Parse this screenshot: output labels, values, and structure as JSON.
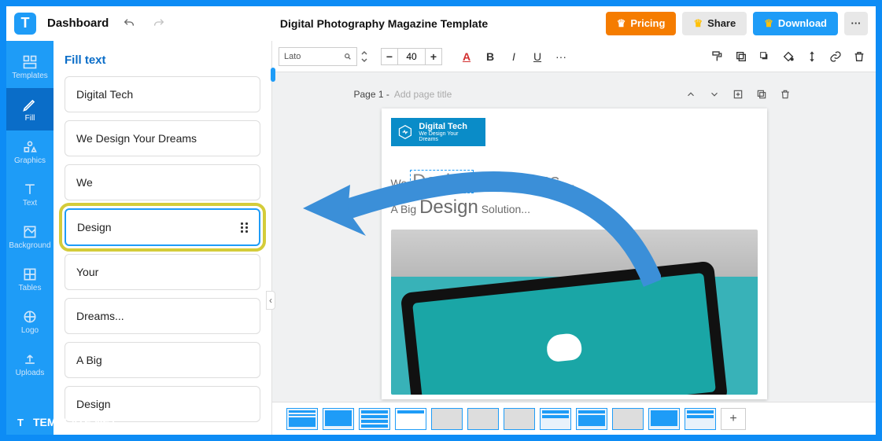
{
  "header": {
    "dashboard": "Dashboard",
    "title": "Digital Photography Magazine Template",
    "pricing": "Pricing",
    "share": "Share",
    "download": "Download"
  },
  "sidenav": [
    {
      "label": "Templates"
    },
    {
      "label": "Fill"
    },
    {
      "label": "Graphics"
    },
    {
      "label": "Text"
    },
    {
      "label": "Background"
    },
    {
      "label": "Tables"
    },
    {
      "label": "Logo"
    },
    {
      "label": "Uploads"
    }
  ],
  "panel": {
    "title": "Fill text",
    "items": [
      {
        "label": "Digital Tech"
      },
      {
        "label": "We Design Your Dreams"
      },
      {
        "label": "We"
      },
      {
        "label": "Design",
        "selected": true
      },
      {
        "label": "Your"
      },
      {
        "label": "Dreams..."
      },
      {
        "label": "A Big"
      },
      {
        "label": "Design"
      }
    ]
  },
  "toolbar": {
    "font": "Lato",
    "font_size": "40"
  },
  "page_header": {
    "page_label": "Page 1 -",
    "placeholder": "Add page title"
  },
  "page_content": {
    "brand": "Digital Tech",
    "brand_sub": "We Design Your Dreams",
    "line1_a": "We",
    "line1_b": "Design",
    "line1_c": "reams...",
    "line2_a": "A Big",
    "line2_b": "Design",
    "line2_c": "Solution..."
  },
  "watermark": "TEMPLATE.NET"
}
